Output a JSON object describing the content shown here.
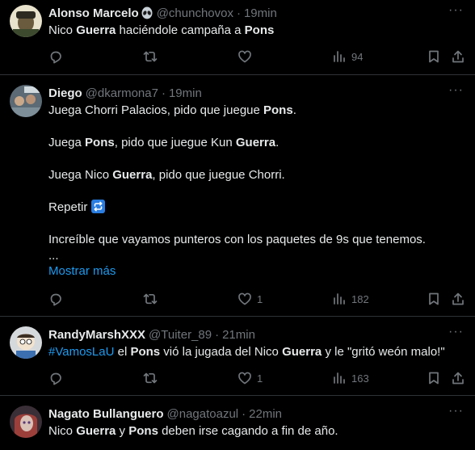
{
  "tweets": [
    {
      "name": "Alonso Marcelo",
      "name_emoji": "👽",
      "handle": "@chunchovox",
      "time": "19min",
      "lines": [
        [
          {
            "t": "Nico "
          },
          {
            "t": "Guerra",
            "b": true
          },
          {
            "t": " haciéndole campaña a "
          },
          {
            "t": "Pons",
            "b": true
          }
        ]
      ],
      "replies": "",
      "retweets": "",
      "likes": "",
      "views": "94"
    },
    {
      "name": "Diego",
      "handle": "@dkarmona7",
      "time": "19min",
      "lines": [
        [
          {
            "t": "Juega Chorri Palacios, pido que juegue "
          },
          {
            "t": "Pons",
            "b": true
          },
          {
            "t": "."
          }
        ],
        [],
        [
          {
            "t": "Juega "
          },
          {
            "t": "Pons",
            "b": true
          },
          {
            "t": ", pido que juegue Kun "
          },
          {
            "t": "Guerra",
            "b": true
          },
          {
            "t": "."
          }
        ],
        [],
        [
          {
            "t": "Juega Nico "
          },
          {
            "t": "Guerra",
            "b": true
          },
          {
            "t": ", pido que juegue Chorri."
          }
        ],
        [],
        [
          {
            "t": "Repetir "
          },
          {
            "emoji": "repeat"
          }
        ],
        [],
        [
          {
            "t": "Increíble que vayamos punteros con los paquetes de 9s que tenemos."
          }
        ],
        [
          {
            "t": "..."
          }
        ]
      ],
      "show_more": "Mostrar más",
      "replies": "",
      "retweets": "",
      "likes": "1",
      "views": "182"
    },
    {
      "name": "RandyMarshXXX",
      "handle": "@Tuiter_89",
      "time": "21min",
      "lines": [
        [
          {
            "t": "#VamosLaU",
            "h": true
          },
          {
            "t": " el "
          },
          {
            "t": "Pons",
            "b": true
          },
          {
            "t": " vió la jugada del Nico "
          },
          {
            "t": "Guerra",
            "b": true
          },
          {
            "t": " y le \"gritó weón malo!\""
          }
        ]
      ],
      "replies": "",
      "retweets": "",
      "likes": "1",
      "views": "163"
    },
    {
      "name": "Nagato Bullanguero",
      "handle": "@nagatoazul",
      "time": "22min",
      "lines": [
        [
          {
            "t": "Nico "
          },
          {
            "t": "Guerra",
            "b": true
          },
          {
            "t": " y "
          },
          {
            "t": "Pons",
            "b": true
          },
          {
            "t": " deben irse cagando a fin de año."
          }
        ]
      ]
    }
  ],
  "icons": {
    "reply": "reply-icon",
    "retweet": "retweet-icon",
    "like": "heart-icon",
    "views": "views-icon",
    "bookmark": "bookmark-icon",
    "share": "share-icon",
    "more": "more-icon",
    "alien": "alien-emoji"
  },
  "colors": {
    "background": "#000000",
    "text": "#e7e9ea",
    "muted": "#71767b",
    "link": "#1d9bf0",
    "divider": "#2f3336"
  },
  "more_glyph": "···"
}
